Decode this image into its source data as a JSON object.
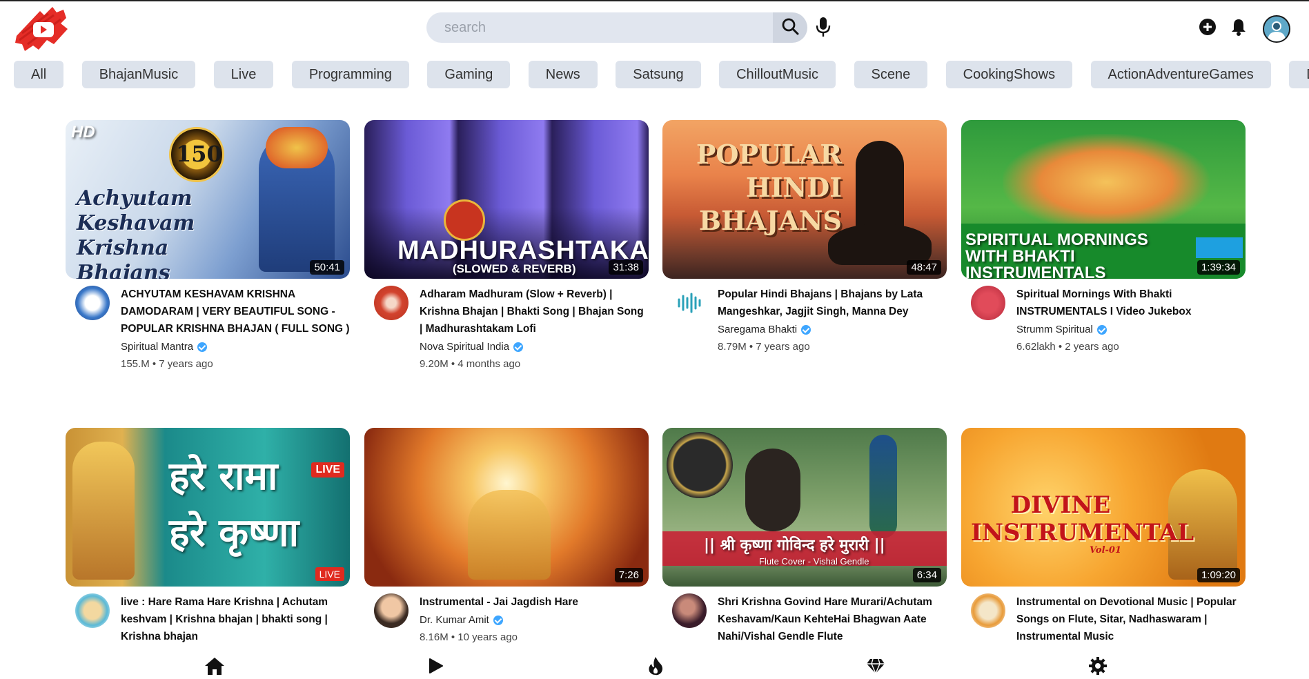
{
  "search": {
    "placeholder": "search"
  },
  "chips": [
    "All",
    "BhajanMusic",
    "Live",
    "Programming",
    "Gaming",
    "News",
    "Satsung",
    "ChilloutMusic",
    "Scene",
    "CookingShows",
    "ActionAdventureGames",
    "Drivi"
  ],
  "videos": [
    {
      "title": "ACHYUTAM KESHAVAM KRISHNA DAMODARAM | VERY BEAUTIFUL SONG - POPULAR KRISHNA BHAJAN ( FULL SONG )",
      "channel": "Spiritual Mantra",
      "stats": "155.M • 7 years ago",
      "duration": "50:41",
      "thumb_text": "Achyutam Keshavam Krishna Bhajans",
      "verified": true
    },
    {
      "title": "Adharam Madhuram (Slow + Reverb) | Krishna Bhajan | Bhakti Song | Bhajan Song | Madhurashtakam Lofi",
      "channel": "Nova Spiritual India",
      "stats": "9.20M • 4 months ago",
      "duration": "31:38",
      "thumb_text": "MADHURASHTAKAM",
      "thumb_sub": "(SLOWED & REVERB)",
      "verified": true
    },
    {
      "title": "Popular Hindi Bhajans | Bhajans by Lata Mangeshkar, Jagjit Singh, Manna Dey",
      "channel": "Saregama Bhakti",
      "stats": "8.79M • 7 years ago",
      "duration": "48:47",
      "thumb_text": "POPULAR HINDI BHAJANS",
      "verified": true
    },
    {
      "title": "Spiritual Mornings With Bhakti INSTRUMENTALS I Video Jukebox",
      "channel": "Strumm Spiritual",
      "stats": "6.62lakh • 2 years ago",
      "duration": "1:39:34",
      "thumb_text": "SPIRITUAL MORNINGS WITH BHAKTI INSTRUMENTALS",
      "verified": true
    },
    {
      "title": "live : Hare Rama Hare Krishna | Achutam keshvam | Krishna bhajan | bhakti song | Krishna bhajan",
      "channel": "",
      "stats": "",
      "duration": "",
      "thumb_text": "हरे रामा हरे कृष्णा",
      "badge": "LIVE",
      "verified": false
    },
    {
      "title": "Instrumental - Jai Jagdish Hare",
      "channel": "Dr. Kumar Amit",
      "stats": "8.16M • 10 years ago",
      "duration": "7:26",
      "thumb_text": "",
      "verified": true
    },
    {
      "title": "Shri Krishna Govind Hare Murari/Achutam Keshavam/Kaun KehteHai Bhagwan Aate Nahi/Vishal Gendle Flute",
      "channel": "",
      "stats": "",
      "duration": "6:34",
      "thumb_text": "|| श्री कृष्णा गोविन्द हरे मुरारी ||",
      "thumb_sub": "Flute Cover - Vishal Gendle",
      "verified": false
    },
    {
      "title": "Instrumental on Devotional Music | Popular Songs on Flute, Sitar, Nadhaswaram | Instrumental Music",
      "channel": "",
      "stats": "",
      "duration": "1:09:20",
      "thumb_text": "DIVINE INSTRUMENTAL",
      "thumb_sub": "Vol-01",
      "verified": false
    }
  ],
  "colors": {
    "chip_bg": "#dde3ec",
    "search_bg": "#e1e6ef",
    "verified": "#3ea6ff",
    "logo_red": "#e52d27"
  },
  "icons": {
    "header": [
      "youtube-logo-icon",
      "search-icon",
      "mic-icon",
      "add-icon",
      "bell-icon",
      "avatar"
    ],
    "nav": [
      "home-icon",
      "play-icon",
      "fire-icon",
      "diamond-icon",
      "settings-icon"
    ]
  }
}
